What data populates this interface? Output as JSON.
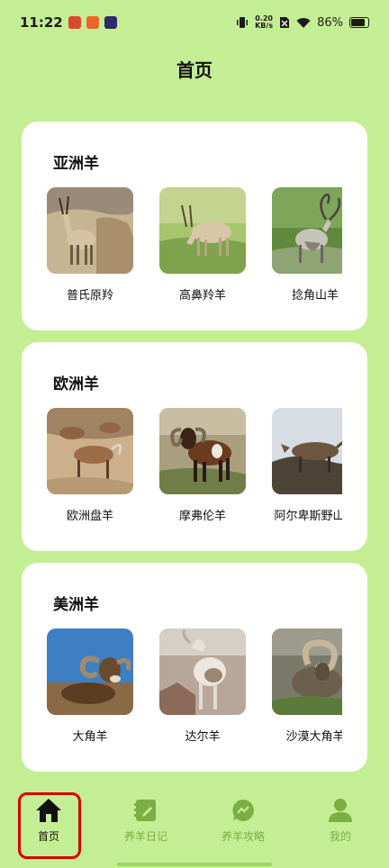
{
  "status_bar": {
    "time": "11:22",
    "net_speed_value": "0.20",
    "net_speed_unit": "KB/s",
    "battery": "86%"
  },
  "header": {
    "title": "首页"
  },
  "sections": [
    {
      "title": "亚洲羊",
      "animals": [
        "普氏原羚",
        "高鼻羚羊",
        "捻角山羊"
      ]
    },
    {
      "title": "欧洲羊",
      "animals": [
        "欧洲盘羊",
        "摩弗伦羊",
        "阿尔卑斯野山羊"
      ]
    },
    {
      "title": "美洲羊",
      "animals": [
        "大角羊",
        "达尔羊",
        "沙漠大角羊"
      ]
    }
  ],
  "tab_bar": {
    "items": [
      {
        "label": "首页",
        "icon": "home-icon",
        "active": true
      },
      {
        "label": "养羊日记",
        "icon": "diary-icon",
        "active": false
      },
      {
        "label": "养羊攻略",
        "icon": "guide-chat-icon",
        "active": false
      },
      {
        "label": "我的",
        "icon": "profile-icon",
        "active": false
      }
    ]
  },
  "colors": {
    "background": "#c4ee94",
    "card": "#ffffff",
    "tab_inactive": "#7cae43",
    "tab_active": "#111111",
    "highlight": "#d40000"
  }
}
